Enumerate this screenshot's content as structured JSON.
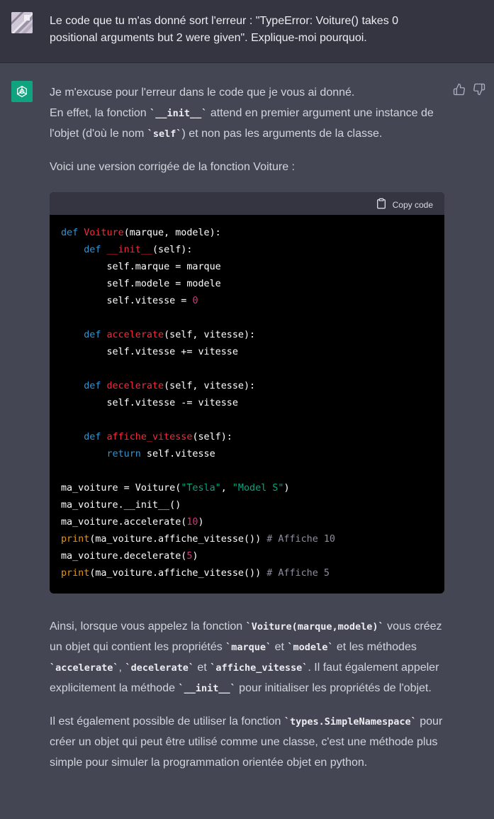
{
  "user_message": {
    "text": "Le code que tu m'as donné sort l'erreur : \"TypeError: Voiture() takes 0 positional arguments but 2 were given\". Explique-moi pourquoi."
  },
  "assistant": {
    "p1_line1": "Je m'excuse pour l'erreur dans le code que je vous ai donné.",
    "p1_a": "En effet, la fonction ",
    "p1_code1": "`__init__`",
    "p1_b": " attend en premier argument une instance de l'objet (d'où le nom ",
    "p1_code2": "`self`",
    "p1_c": ") et non pas les arguments de la classe.",
    "p2": "Voici une version corrigée de la fonction Voiture :",
    "copy_label": "Copy code",
    "code": {
      "l1_kw": "def",
      "l1_fn": "Voiture",
      "l1_rest": "(marque, modele):",
      "l2_kw": "def",
      "l2_fn": "__init__",
      "l2_rest": "(self):",
      "l3": "self.marque = marque",
      "l4": "self.modele = modele",
      "l5": "self.vitesse = ",
      "l5_num": "0",
      "l7_kw": "def",
      "l7_fn": "accelerate",
      "l7_rest": "(self, vitesse):",
      "l8": "self.vitesse += vitesse",
      "l10_kw": "def",
      "l10_fn": "decelerate",
      "l10_rest": "(self, vitesse):",
      "l11": "self.vitesse -= vitesse",
      "l13_kw": "def",
      "l13_fn": "affiche_vitesse",
      "l13_rest": "(self):",
      "l14_kw": "return",
      "l14_rest": " self.vitesse",
      "l16_a": "ma_voiture = Voiture(",
      "l16_s1": "\"Tesla\"",
      "l16_b": ", ",
      "l16_s2": "\"Model S\"",
      "l16_c": ")",
      "l17": "ma_voiture.__init__()",
      "l18_a": "ma_voiture.accelerate(",
      "l18_num": "10",
      "l18_b": ")",
      "l19_bi": "print",
      "l19_a": "(ma_voiture.affiche_vitesse()) ",
      "l19_cm": "# Affiche 10",
      "l20_a": "ma_voiture.decelerate(",
      "l20_num": "5",
      "l20_b": ")",
      "l21_bi": "print",
      "l21_a": "(ma_voiture.affiche_vitesse()) ",
      "l21_cm": "# Affiche 5"
    },
    "p3_a": "Ainsi, lorsque vous appelez la fonction ",
    "p3_code1": "`Voiture(marque,modele)`",
    "p3_b": " vous créez un objet qui contient les propriétés ",
    "p3_code2": "`marque`",
    "p3_c": " et ",
    "p3_code3": "`modele`",
    "p3_d": " et les méthodes ",
    "p3_code4": "`accelerate`",
    "p3_e": ", ",
    "p3_code5": "`decelerate`",
    "p3_f": " et ",
    "p3_code6": "`affiche_vitesse`",
    "p3_g": ". Il faut également appeler explicitement la méthode ",
    "p3_code7": "`__init__`",
    "p3_h": " pour initialiser les propriétés de l'objet.",
    "p4_a": "Il est également possible de utiliser la fonction ",
    "p4_code1": "`types.SimpleNamespace`",
    "p4_b": " pour créer un objet qui peut être utilisé comme une classe, c'est une méthode plus simple pour simuler la programmation orientée objet en python."
  },
  "icons": {
    "user_avatar": "user-avatar-icon",
    "assistant_avatar": "openai-logo-icon",
    "copy": "clipboard-icon",
    "thumbs_up": "thumbs-up-icon",
    "thumbs_down": "thumbs-down-icon"
  },
  "colors": {
    "page_bg": "#444654",
    "user_bg": "#343541",
    "assistant_avatar_bg": "#10a37f",
    "code_bg": "#000000",
    "keyword": "#2e95d3",
    "function": "#f22c3d",
    "number": "#df3079",
    "string": "#00a67d",
    "builtin": "#e9950c",
    "comment": "#8e8ea0"
  }
}
